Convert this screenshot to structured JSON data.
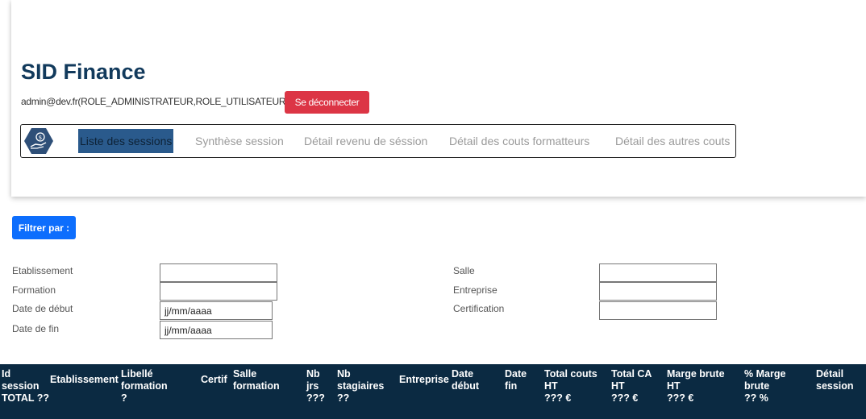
{
  "app": {
    "title": "SID Finance",
    "user": "admin@dev.fr(ROLE_ADMINISTRATEUR,ROLE_UTILISATEUR)",
    "logout_label": "Se déconnecter"
  },
  "nav": {
    "logo_icon": "money-hand-icon",
    "items": [
      {
        "label": "Liste des sessions",
        "active": true
      },
      {
        "label": "Synthèse session",
        "active": false
      },
      {
        "label": "Détail revenu de séssion",
        "active": false
      },
      {
        "label": "Détail des couts formatteurs",
        "active": false
      },
      {
        "label": "Détail des autres couts",
        "active": false
      }
    ]
  },
  "filters": {
    "button_label": "Filtrer par :",
    "left": [
      {
        "label": "Etablissement",
        "value": ""
      },
      {
        "label": "Formation",
        "value": ""
      },
      {
        "label": "Date de début",
        "value": "jj/mm/aaaa"
      },
      {
        "label": "Date de fin",
        "value": "jj/mm/aaaa"
      }
    ],
    "right": [
      {
        "label": "Salle",
        "value": ""
      },
      {
        "label": "Entreprise",
        "value": ""
      },
      {
        "label": "Certification",
        "value": ""
      }
    ]
  },
  "table": {
    "columns": [
      {
        "lines": [
          "Id",
          "session",
          "TOTAL ??"
        ]
      },
      {
        "lines": [
          "Etablissement"
        ]
      },
      {
        "lines": [
          "Libellé",
          "formation",
          "?"
        ]
      },
      {
        "lines": [
          "Certif"
        ]
      },
      {
        "lines": [
          "Salle",
          "formation"
        ]
      },
      {
        "lines": [
          "Nb",
          "jrs",
          "???"
        ]
      },
      {
        "lines": [
          "Nb",
          "stagiaires",
          "??"
        ]
      },
      {
        "lines": [
          "Entreprise"
        ]
      },
      {
        "lines": [
          "Date",
          "début"
        ]
      },
      {
        "lines": [
          "Date",
          "fin"
        ]
      },
      {
        "lines": [
          "Total couts",
          "HT",
          "??? €"
        ]
      },
      {
        "lines": [
          "Total CA",
          "HT",
          "??? €"
        ]
      },
      {
        "lines": [
          "Marge brute",
          "HT",
          "??? €"
        ]
      },
      {
        "lines": [
          "% Marge",
          "brute",
          "?? %"
        ]
      },
      {
        "lines": [
          "Détail",
          "session"
        ]
      }
    ]
  },
  "colors": {
    "brand": "#123a5c",
    "nav_active": "#2a5a8c",
    "danger": "#dc3545",
    "primary": "#0d6efd",
    "table_header": "#0b2a42"
  }
}
